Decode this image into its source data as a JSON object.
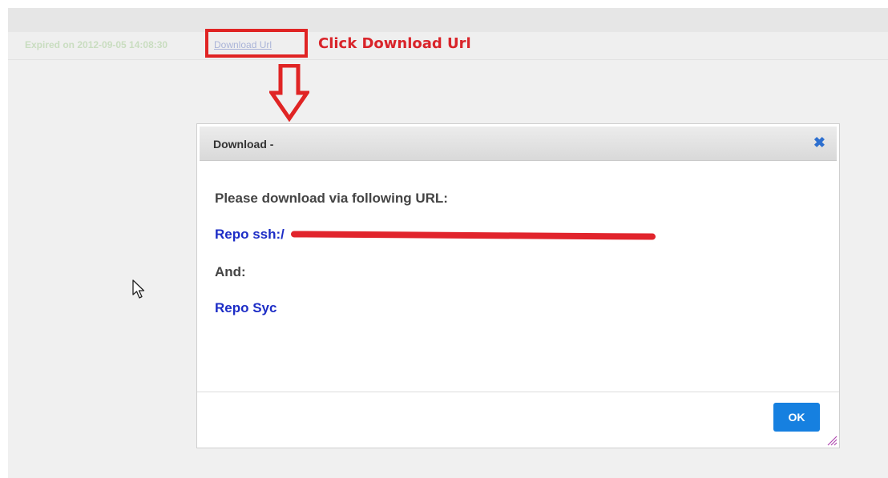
{
  "info_row": {
    "expired_text": "Expired on 2012-09-05 14:08:30",
    "download_link": "Download Url"
  },
  "annotation": {
    "text": "Click Download Url",
    "color": "#d9242a"
  },
  "dialog": {
    "title": "Download -",
    "close_icon": "close-icon",
    "message": "Please download via following URL:",
    "repo_ssh_label": "Repo ssh:/",
    "and_label": "And:",
    "repo_sync_label": "Repo Syc",
    "ok_label": "OK"
  },
  "colors": {
    "accent": "#1680e0",
    "link": "#1d2dc6",
    "annotation_red": "#e02424"
  }
}
